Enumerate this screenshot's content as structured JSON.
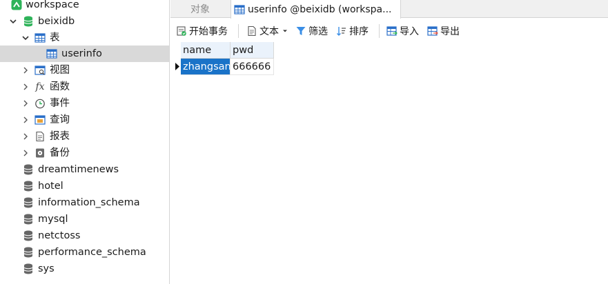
{
  "sidebar": {
    "connection": {
      "label": "workspace",
      "icon": "connection-icon"
    },
    "database": {
      "label": "beixidb",
      "icon": "database-icon"
    },
    "tables_group": {
      "label": "表",
      "icon": "table-group-icon"
    },
    "table_item": {
      "label": "userinfo",
      "icon": "table-icon"
    },
    "groups": [
      {
        "label": "视图",
        "icon": "view-icon"
      },
      {
        "label": "函数",
        "icon": "function-icon"
      },
      {
        "label": "事件",
        "icon": "event-clock-icon"
      },
      {
        "label": "查询",
        "icon": "query-icon"
      },
      {
        "label": "报表",
        "icon": "report-icon"
      },
      {
        "label": "备份",
        "icon": "backup-icon"
      }
    ],
    "other_databases": [
      {
        "label": "dreamtimenews"
      },
      {
        "label": "hotel"
      },
      {
        "label": "information_schema"
      },
      {
        "label": "mysql"
      },
      {
        "label": "netctoss"
      },
      {
        "label": "performance_schema"
      },
      {
        "label": "sys"
      }
    ]
  },
  "tabs": {
    "objects": "对象",
    "active": "userinfo @beixidb (workspa..."
  },
  "toolbar": {
    "begin_transaction": "开始事务",
    "text": "文本",
    "filter": "筛选",
    "sort": "排序",
    "import": "导入",
    "export": "导出"
  },
  "grid": {
    "columns": [
      "name",
      "pwd"
    ],
    "rows": [
      [
        "zhangsan",
        "666666"
      ]
    ]
  },
  "colors": {
    "selection": "#1a73c8",
    "header_bg": "#eaf2fb",
    "tree_selected": "#d9d9d9",
    "connection_green": "#2fb35a"
  }
}
